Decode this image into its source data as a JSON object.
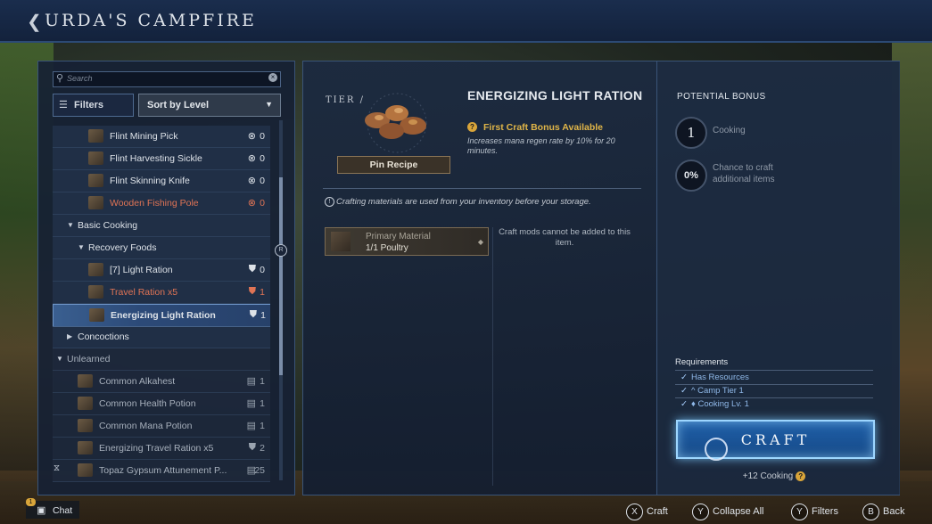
{
  "header": {
    "title": "URDA'S CAMPFIRE"
  },
  "search": {
    "placeholder": "Search"
  },
  "filters": {
    "label": "Filters",
    "sort_label": "Sort by Level"
  },
  "recipes": [
    {
      "name": "Flint Mining Pick",
      "count": "0",
      "style": "normal",
      "indent": 2,
      "status": "x"
    },
    {
      "name": "Flint Harvesting Sickle",
      "count": "0",
      "style": "normal",
      "indent": 2,
      "status": "x"
    },
    {
      "name": "Flint Skinning Knife",
      "count": "0",
      "style": "normal",
      "indent": 2,
      "status": "x"
    },
    {
      "name": "Wooden Fishing Pole",
      "count": "0",
      "style": "red",
      "indent": 2,
      "status": "x"
    },
    {
      "name": "Basic Cooking",
      "style": "category",
      "indent": 0
    },
    {
      "name": "Recovery Foods",
      "style": "category",
      "indent": 1
    },
    {
      "name": "[7] Light Ration",
      "count": "0",
      "style": "normal",
      "indent": 2,
      "status": "shield"
    },
    {
      "name": "Travel Ration x5",
      "count": "1",
      "style": "red",
      "indent": 2,
      "status": "shield"
    },
    {
      "name": "Energizing Light Ration",
      "count": "1",
      "style": "selected",
      "indent": 2,
      "status": "shield"
    },
    {
      "name": "Concoctions",
      "style": "category-collapsed",
      "indent": 0
    },
    {
      "name": "Unlearned",
      "style": "category-dim",
      "indent": -1
    },
    {
      "name": "Common Alkahest",
      "count": "1",
      "style": "dim",
      "indent": 1,
      "status": "scroll"
    },
    {
      "name": "Common Health Potion",
      "count": "1",
      "style": "dim",
      "indent": 1,
      "status": "scroll"
    },
    {
      "name": "Common Mana Potion",
      "count": "1",
      "style": "dim",
      "indent": 1,
      "status": "scroll"
    },
    {
      "name": "Energizing Travel Ration x5",
      "count": "2",
      "style": "dim",
      "indent": 1,
      "status": "shield"
    },
    {
      "name": "Topaz Gypsum Attunement P...",
      "count": "25",
      "style": "dim",
      "indent": 1,
      "status": "scroll"
    }
  ],
  "scroll_hint": "R",
  "detail": {
    "tier": "TIER /",
    "pin_label": "Pin Recipe",
    "title": "ENERGIZING LIGHT RATION",
    "bonus_title": "First Craft Bonus Available",
    "bonus_desc": "Increases mana regen rate by 10% for 20 minutes.",
    "info": "Crafting materials are used from your inventory before your storage.",
    "material_label": "Primary Material",
    "material_value": "1/1 Poultry",
    "mods_note": "Craft mods cannot be added to this item."
  },
  "potential_bonus": {
    "title": "POTENTIAL BONUS",
    "level": "1",
    "level_label": "Cooking",
    "chance": "0%",
    "chance_label": "Chance to craft additional items"
  },
  "requirements": {
    "title": "Requirements",
    "items": [
      "Has Resources",
      "Camp Tier 1",
      "Cooking Lv. 1"
    ]
  },
  "craft": {
    "label": "CRAFT",
    "xp": "+12 Cooking"
  },
  "bottom": {
    "chat_badge": "1",
    "chat": "Chat",
    "hints": [
      {
        "key": "X",
        "label": "Craft"
      },
      {
        "key": "Y",
        "label": "Collapse All"
      },
      {
        "key": "Y",
        "label": "Filters"
      },
      {
        "key": "B",
        "label": "Back"
      }
    ]
  }
}
